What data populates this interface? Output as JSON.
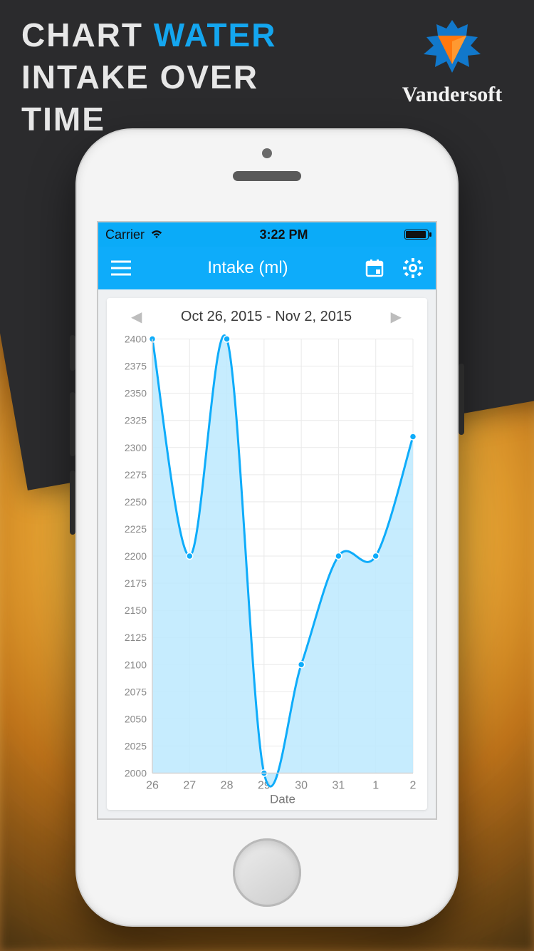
{
  "promo": {
    "line1_a": "CHART ",
    "line1_b": "WATER",
    "line2": "INTAKE OVER",
    "line3": "TIME"
  },
  "brand": {
    "name": "Vandersoft"
  },
  "status": {
    "carrier": "Carrier",
    "time": "3:22 PM"
  },
  "navbar": {
    "title": "Intake (ml)"
  },
  "date_range": {
    "label": "Oct 26, 2015 - Nov 2, 2015"
  },
  "colors": {
    "accent": "#1aa9f0",
    "line": "#1aa9f0",
    "fill": "#bfe7fb",
    "grid": "#e9e9e9",
    "tick": "#9a9a9a"
  },
  "chart_data": {
    "type": "area",
    "title": "Intake (ml)",
    "xlabel": "Date",
    "ylabel": "",
    "x_ticks": [
      "26",
      "27",
      "28",
      "29",
      "30",
      "31",
      "1",
      "2"
    ],
    "y_ticks": [
      2000,
      2025,
      2050,
      2075,
      2100,
      2125,
      2150,
      2175,
      2200,
      2225,
      2250,
      2275,
      2300,
      2325,
      2350,
      2375,
      2400
    ],
    "ylim": [
      2000,
      2400
    ],
    "series": [
      {
        "name": "Intake",
        "values": [
          2400,
          2200,
          2400,
          2000,
          2100,
          2200,
          2200,
          2310
        ]
      }
    ]
  }
}
